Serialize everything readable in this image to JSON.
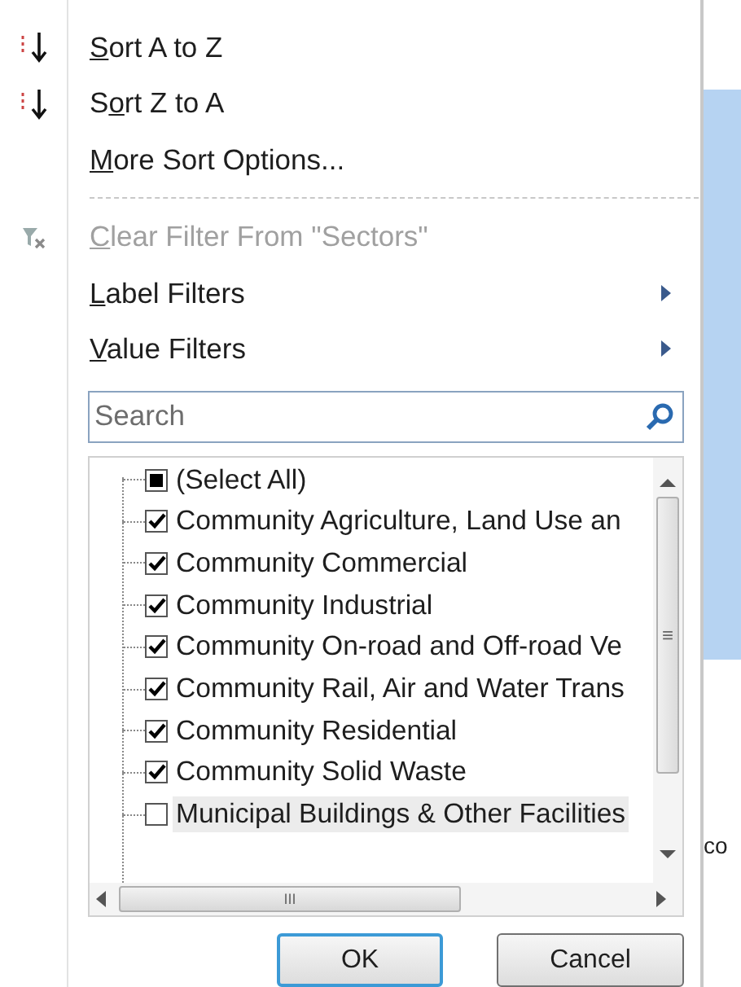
{
  "menu": [
    {
      "key": "S",
      "after": "ort A to Z",
      "kind": "sort-asc",
      "disabled": false,
      "submenu": false
    },
    {
      "before": "S",
      "key": "o",
      "after": "rt Z to A",
      "kind": "sort-desc",
      "disabled": false,
      "submenu": false
    },
    {
      "key": "M",
      "after": "ore Sort Options...",
      "kind": "plain",
      "disabled": false,
      "submenu": false
    },
    {
      "kind": "separator"
    },
    {
      "key": "C",
      "after": "lear Filter From \"Sectors\"",
      "kind": "clear-filter",
      "disabled": true,
      "submenu": false
    },
    {
      "key": "L",
      "after": "abel Filters",
      "kind": "plain",
      "disabled": false,
      "submenu": true
    },
    {
      "key": "V",
      "after": "alue Filters",
      "kind": "plain",
      "disabled": false,
      "submenu": true
    }
  ],
  "search": {
    "placeholder": "Search"
  },
  "items": [
    {
      "label": "(Select All)",
      "checked": false,
      "indeterminate": true,
      "highlighted": false
    },
    {
      "label": "Community Agriculture, Land Use an",
      "checked": true,
      "indeterminate": false,
      "highlighted": false
    },
    {
      "label": "Community Commercial",
      "checked": true,
      "indeterminate": false,
      "highlighted": false
    },
    {
      "label": "Community Industrial",
      "checked": true,
      "indeterminate": false,
      "highlighted": false
    },
    {
      "label": "Community On-road and Off-road Ve",
      "checked": true,
      "indeterminate": false,
      "highlighted": false
    },
    {
      "label": "Community Rail, Air and Water Trans",
      "checked": true,
      "indeterminate": false,
      "highlighted": false
    },
    {
      "label": "Community Residential",
      "checked": true,
      "indeterminate": false,
      "highlighted": false
    },
    {
      "label": "Community Solid Waste",
      "checked": true,
      "indeterminate": false,
      "highlighted": false
    },
    {
      "label": "Municipal Buildings & Other Facilities",
      "checked": false,
      "indeterminate": false,
      "highlighted": true
    }
  ],
  "scroll_arrows": {
    "horizontal_thumb": "III",
    "vertical_thumb": "≡"
  },
  "buttons": [
    {
      "label": "OK",
      "default": true
    },
    {
      "label": "Cancel",
      "default": false
    }
  ],
  "background": {
    "cell_text": "co"
  }
}
